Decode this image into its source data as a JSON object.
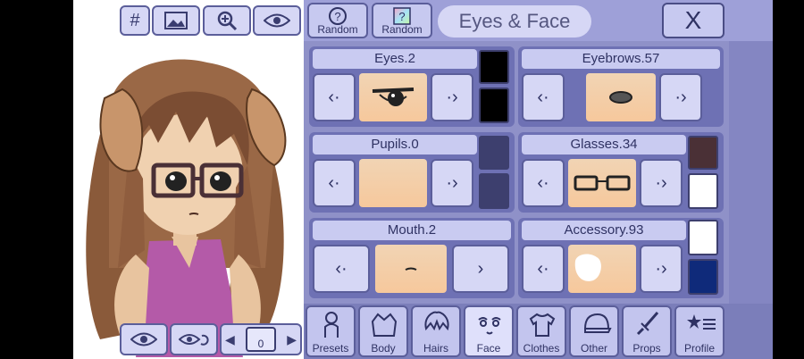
{
  "stage_toolbar": {
    "grid_label": "#",
    "icons": [
      "image-icon",
      "zoom-in-icon",
      "eye-icon"
    ]
  },
  "header": {
    "random1": "Random",
    "random2": "Random",
    "title": "Eyes & Face",
    "close": "X"
  },
  "cards": {
    "eyes": "Eyes.2",
    "eyebrows": "Eyebrows.57",
    "pupils": "Pupils.0",
    "glasses": "Glasses.34",
    "mouth": "Mouth.2",
    "accessory": "Accessory.93"
  },
  "colors": {
    "eyes_1": "#000000",
    "eyes_2": "#000000",
    "glasses_1": "#4a3036",
    "glasses_2": "#ffffff",
    "accessory_1": "#ffffff",
    "accessory_2": "#0f2a7a"
  },
  "tabs": [
    "Presets",
    "Body",
    "Hairs",
    "Face",
    "Clothes",
    "Other",
    "Props",
    "Profile"
  ],
  "bottom": {
    "layer_value": "0"
  }
}
